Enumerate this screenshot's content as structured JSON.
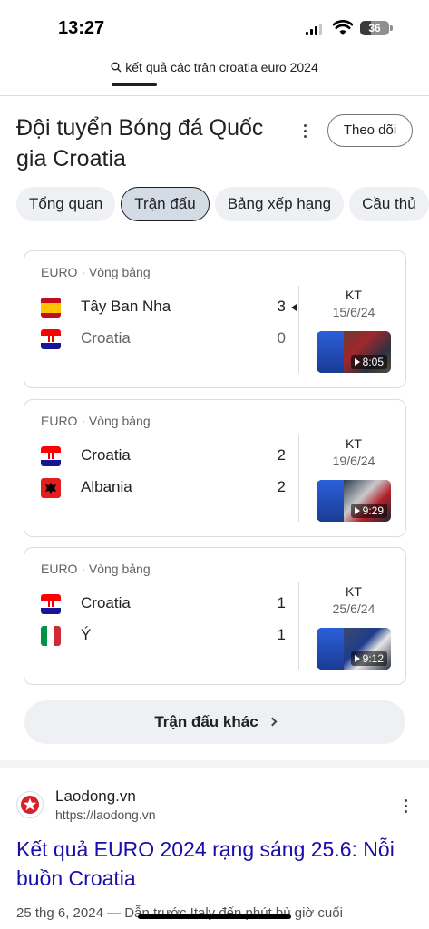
{
  "status_bar": {
    "time": "13:27",
    "battery": "36"
  },
  "search": {
    "query": "kết quả các trận croatia euro 2024"
  },
  "entity": {
    "title": "Đội tuyển Bóng đá Quốc gia Croatia",
    "follow_label": "Theo dõi"
  },
  "chips": [
    "Tổng quan",
    "Trận đấu",
    "Bảng xếp hạng",
    "Cầu thủ"
  ],
  "active_chip": "Trận đấu",
  "matches": [
    {
      "league": "EURO · Vòng bảng",
      "home": {
        "name": "Tây Ban Nha",
        "score": "3",
        "flag": "spain-flag"
      },
      "away": {
        "name": "Croatia",
        "score": "0",
        "flag": "croatia-flag"
      },
      "status": "KT",
      "date": "15/6/24",
      "video_duration": "8:05"
    },
    {
      "league": "EURO · Vòng bảng",
      "home": {
        "name": "Croatia",
        "score": "2",
        "flag": "croatia-flag"
      },
      "away": {
        "name": "Albania",
        "score": "2",
        "flag": "albania-flag"
      },
      "status": "KT",
      "date": "19/6/24",
      "video_duration": "9:29"
    },
    {
      "league": "EURO · Vòng bảng",
      "home": {
        "name": "Croatia",
        "score": "1",
        "flag": "croatia-flag"
      },
      "away": {
        "name": "Ý",
        "score": "1",
        "flag": "italy-flag"
      },
      "status": "KT",
      "date": "25/6/24",
      "video_duration": "9:12"
    }
  ],
  "more_matches_label": "Trận đấu khác",
  "result": {
    "site_name": "Laodong.vn",
    "url": "https://laodong.vn",
    "title": "Kết quả EURO 2024 rạng sáng 25.6: Nỗi buồn Croatia",
    "date": "25 thg 6, 2024",
    "snippet": "Dẫn trước Italy đến phút bù giờ cuối"
  },
  "colors": {
    "link": "#1a0dab",
    "chip_active": "#d3dbe5",
    "chip": "#eef0f3"
  }
}
